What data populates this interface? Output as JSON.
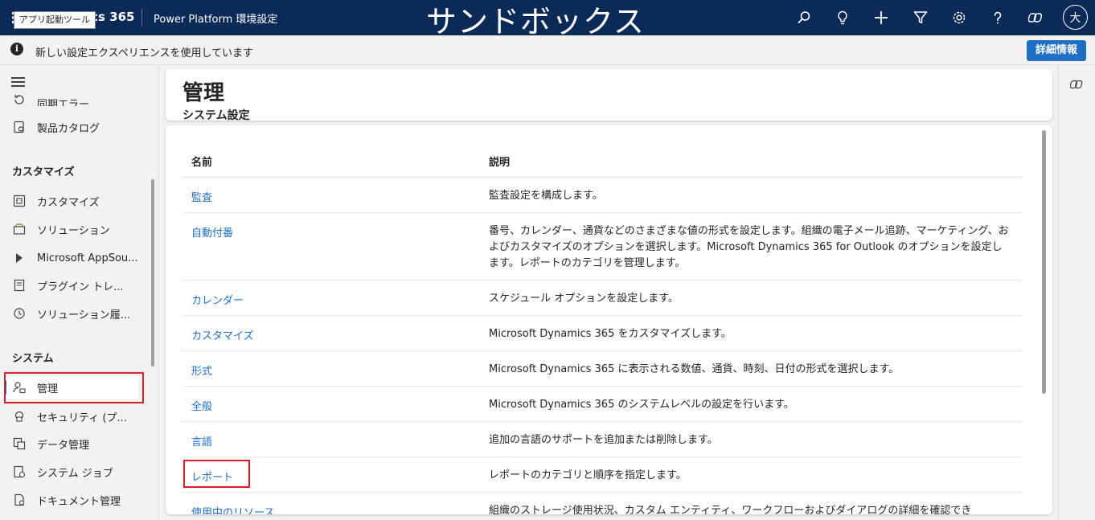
{
  "topbar": {
    "app_name": "ics 365",
    "app_launcher_tooltip": "アプリ起動ツール",
    "environment_title": "Power Platform 環境設定",
    "overlay_caption": "サンドボックス",
    "avatar_initial": "大",
    "icons": [
      "search-icon",
      "lightbulb-icon",
      "add-icon",
      "filter-icon",
      "gear-icon",
      "help-icon",
      "copilot-icon"
    ]
  },
  "notification": {
    "text": "新しい設定エクスペリエンスを使用しています",
    "button_label": "詳細情報"
  },
  "sidebar": {
    "partial_item": "同期エラー",
    "items_top": [
      {
        "label": "製品カタログ",
        "icon": "catalog-icon"
      }
    ],
    "section_customize": "カスタマイズ",
    "items_customize": [
      {
        "label": "カスタマイズ",
        "icon": "customize-icon"
      },
      {
        "label": "ソリューション",
        "icon": "solution-icon"
      },
      {
        "label": "Microsoft AppSou...",
        "icon": "appsource-icon"
      },
      {
        "label": "プラグイン トレ...",
        "icon": "plugin-trace-icon"
      },
      {
        "label": "ソリューション履...",
        "icon": "history-icon"
      }
    ],
    "section_system": "システム",
    "items_system": [
      {
        "label": "管理",
        "icon": "admin-icon",
        "selected": true
      },
      {
        "label": "セキュリティ (プ...",
        "icon": "security-icon"
      },
      {
        "label": "データ管理",
        "icon": "data-management-icon"
      },
      {
        "label": "システム ジョブ",
        "icon": "system-jobs-icon"
      },
      {
        "label": "ドキュメント管理",
        "icon": "document-management-icon"
      }
    ]
  },
  "header": {
    "title": "管理",
    "subtitle": "システム設定"
  },
  "table": {
    "columns": [
      "名前",
      "説明"
    ],
    "rows": [
      {
        "name": "監査",
        "description": "監査設定を構成します。"
      },
      {
        "name": "自動付番",
        "description": "番号、カレンダー、通貨などのさまざまな値の形式を設定します。組織の電子メール追跡、マーケティング、およびカスタマイズのオプションを選択します。Microsoft Dynamics 365 for Outlook のオプションを設定します。レポートのカテゴリを管理します。"
      },
      {
        "name": "カレンダー",
        "description": "スケジュール オプションを設定します。"
      },
      {
        "name": "カスタマイズ",
        "description": "Microsoft Dynamics 365 をカスタマイズします。"
      },
      {
        "name": "形式",
        "description": "Microsoft Dynamics 365 に表示される数値、通貨、時刻、日付の形式を選択します。"
      },
      {
        "name": "全般",
        "description": "Microsoft Dynamics 365 のシステムレベルの設定を行います。"
      },
      {
        "name": "言語",
        "description": "追加の言語のサポートを追加または削除します。"
      },
      {
        "name": "レポート",
        "description": "レポートのカテゴリと順序を指定します。"
      },
      {
        "name": "使用中のリソース",
        "description": "組織のストレージ使用状況、カスタム エンティティ、ワークフローおよびダイアログの詳細を確認でき"
      }
    ]
  },
  "colors": {
    "topbar_bg": "#0b2a57",
    "link": "#1f6fc5",
    "highlight_box": "#d32029",
    "button_bg": "#1f6fc5"
  }
}
